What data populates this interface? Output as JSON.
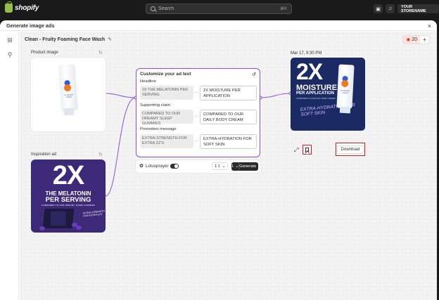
{
  "topbar": {
    "brand": "shopify",
    "search_placeholder": "Search",
    "search_shortcut": "⌘K",
    "store_name": "YOUR STORENAME"
  },
  "sheet": {
    "title": "Generate image ads",
    "close": "×"
  },
  "canvas": {
    "breadcrumb": "Clean - Fruity Foaming Face Wash",
    "credits": "20",
    "credits_add": "+"
  },
  "product_image": {
    "label": "Product image",
    "tube_text": "MY BRAND FRESH"
  },
  "inspiration_ad": {
    "label": "Inspiration ad",
    "big": "2X",
    "line1": "THE MELATONIN",
    "line2": "PER SERVING",
    "line3": "COMPARED TO OUR DREAMY SLEEP GUMMIES",
    "side": "EXTRA-STRENGTH FOR EXTRA ZZ'S"
  },
  "editor": {
    "title": "Customize your ad text",
    "fields": [
      {
        "label": "Headline",
        "original": "2X THE MELATONIN PER SERVING",
        "new": "2X MOISTURE PER APPLICATION"
      },
      {
        "label": "Supporting claim",
        "original": "COMPARED TO OUR DREAMY SLEEP GUMMIES",
        "new": "COMPARED TO OUR DAILY BODY CREAM"
      },
      {
        "label": "Promotion message",
        "original": "EXTRA-STRENGTH FOR EXTRA ZZ'S",
        "new": "EXTRA-HYDRATION FOR SOFT SKIN"
      }
    ],
    "arrow": "→"
  },
  "generate_bar": {
    "model": "Lotusprayer",
    "ratio": "1:1",
    "quantity": "1",
    "generate": "Generate"
  },
  "result": {
    "date": "Mar 17, 9:30 PM",
    "big": "2X",
    "line1": "MOISTURE",
    "line2": "PER APPLICATION",
    "line3": "COMPARED TO OUR DAILY BODY CREAM",
    "hydration": "EXTRA-HYDRATION FOR SOFT SKIN",
    "download": "Download"
  }
}
